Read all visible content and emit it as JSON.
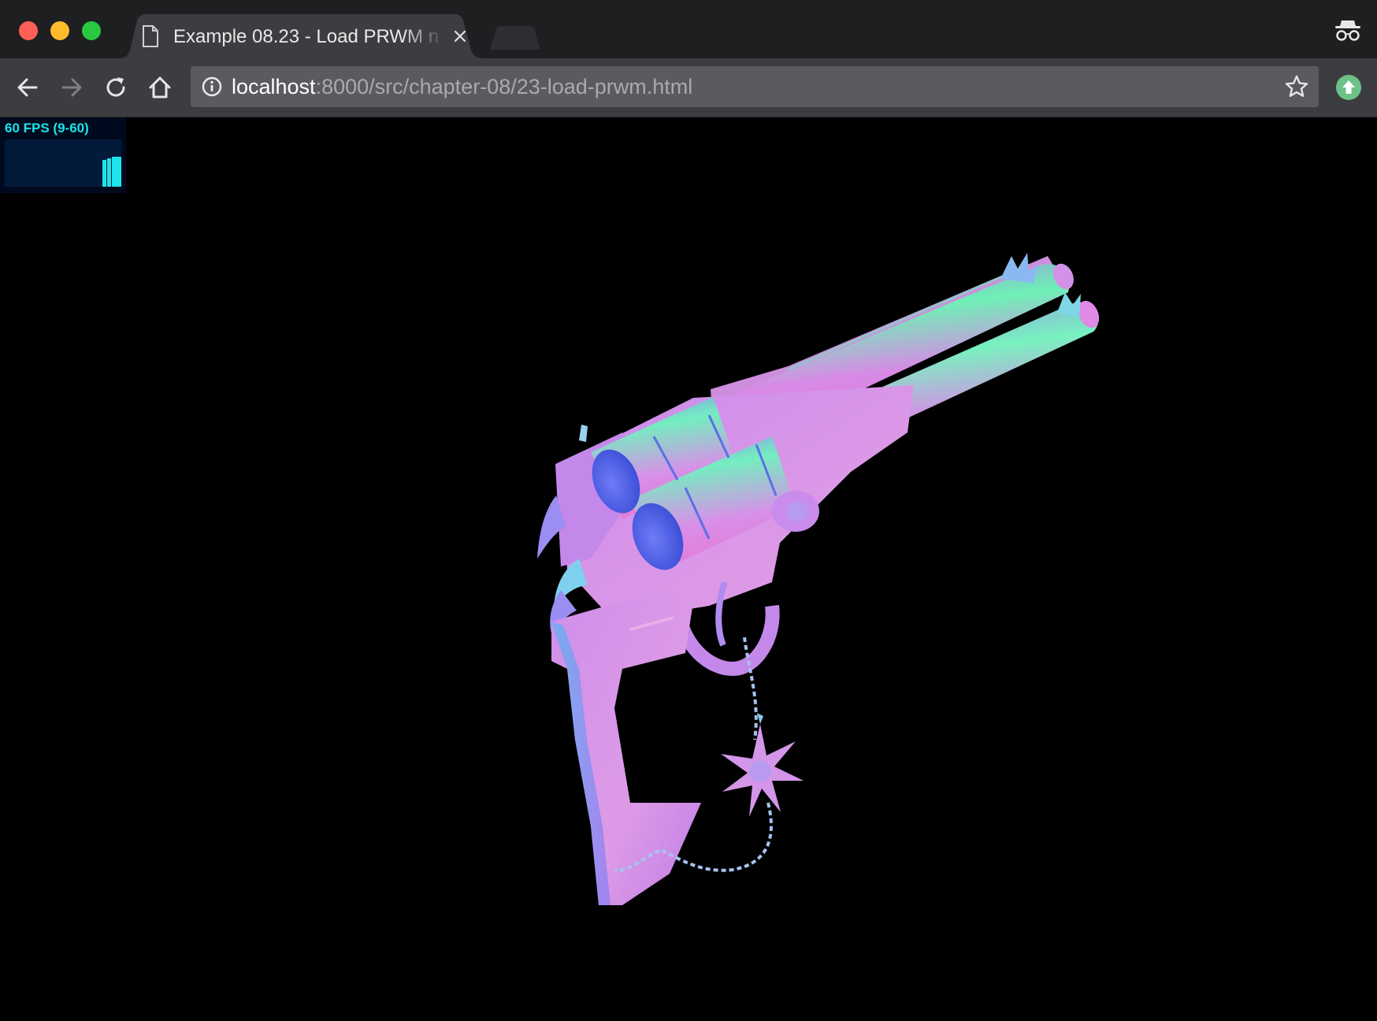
{
  "browser": {
    "tab": {
      "title": "Example 08.23 - Load PRWM n",
      "page_icon": "page-icon",
      "close_icon": "close-icon"
    },
    "incognito_icon": "incognito-icon",
    "toolbar": {
      "back_icon": "back-arrow-icon",
      "forward_icon": "forward-arrow-icon",
      "reload_icon": "reload-icon",
      "home_icon": "home-icon",
      "info_icon": "info-icon",
      "url_host": "localhost",
      "url_rest": ":8000/src/chapter-08/23-load-prwm.html",
      "bookmark_icon": "star-icon",
      "update_icon": "update-icon"
    }
  },
  "stats": {
    "label": "60 FPS (9-60)",
    "text_color": "#1de4ea",
    "bg_color": "#000a1e"
  },
  "scene": {
    "description_colors": {
      "magenta": "#e07ee8",
      "violet": "#9a78f0",
      "mint": "#6ef0b8",
      "blue": "#4060e8"
    }
  }
}
